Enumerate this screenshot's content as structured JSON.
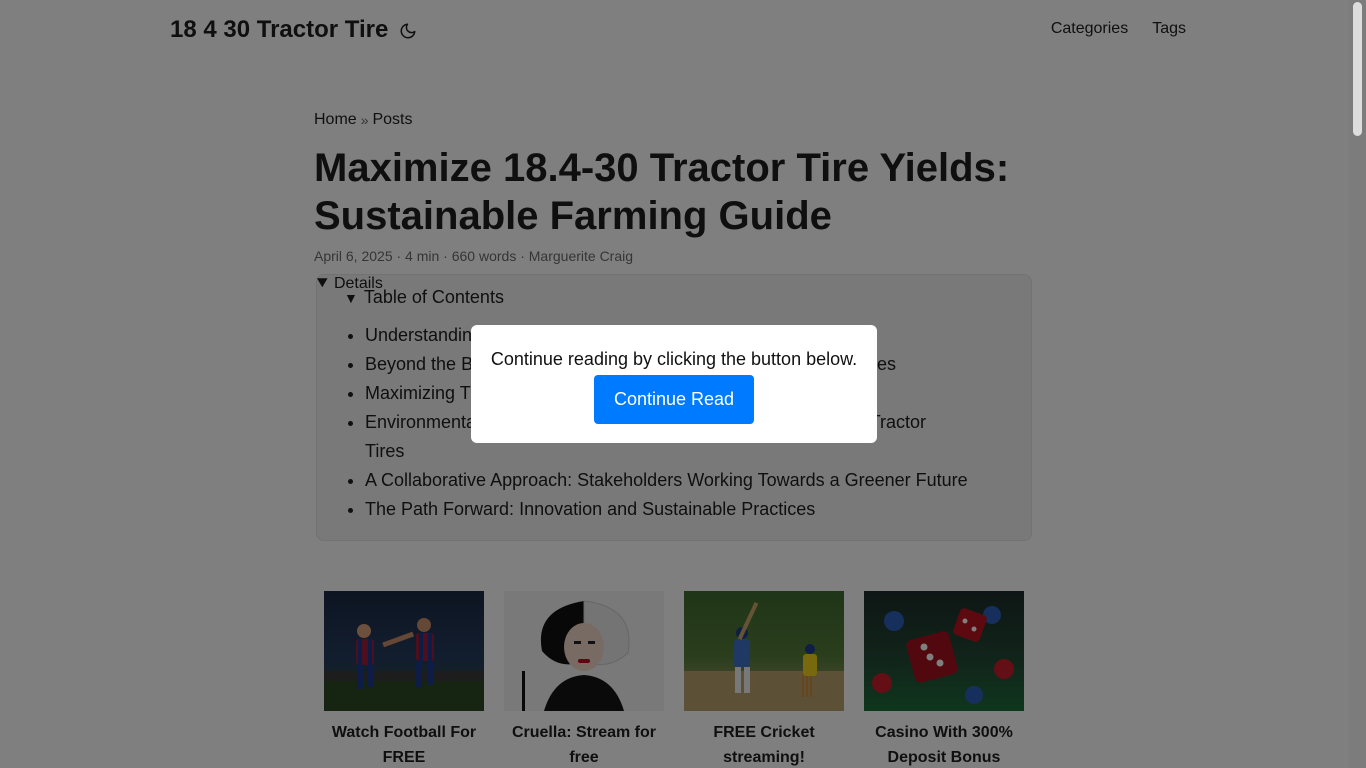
{
  "header": {
    "site_title": "18 4 30 Tractor Tire",
    "theme_icon": "moon-icon",
    "nav": [
      {
        "label": "Categories"
      },
      {
        "label": "Tags"
      }
    ]
  },
  "breadcrumb": {
    "home": "Home",
    "separator": "»",
    "posts": "Posts"
  },
  "article": {
    "title": "Maximize 18.4-30 Tractor Tire Yields: Sustainable Farming Guide",
    "meta": "April 6, 2025 · 4 min · 660 words · Marguerite Craig"
  },
  "toc": {
    "summary": "Table of Contents",
    "items": [
      {
        "label": "Understanding"
      },
      {
        "label": "Beyond the B"
      },
      {
        "label": "Maximizing Tr"
      },
      {
        "label": "Environmenta"
      },
      {
        "label": "A Collaborative Approach: Stakeholders Working Towards a Greener Future"
      },
      {
        "label": "The Path Forward: Innovation and Sustainable Practices"
      }
    ],
    "partial_tails": [
      {
        "label": "ctor Tires"
      },
      {
        "label": "30 Tractor"
      },
      {
        "label": "Tires"
      }
    ]
  },
  "cards": [
    {
      "label": "Watch Football For FREE",
      "image_icon": "football-players-image"
    },
    {
      "label": "Cruella: Stream for free",
      "image_icon": "cruella-portrait-image"
    },
    {
      "label": "FREE Cricket streaming!",
      "image_icon": "cricket-batsman-image"
    },
    {
      "label": "Casino With 300% Deposit Bonus",
      "image_icon": "casino-dice-image"
    }
  ],
  "modal": {
    "text": "Continue reading by clicking the button below.",
    "button": "Continue Read"
  },
  "colors": {
    "accent": "#007bff",
    "overlay": "rgba(0,0,0,0.5)"
  }
}
